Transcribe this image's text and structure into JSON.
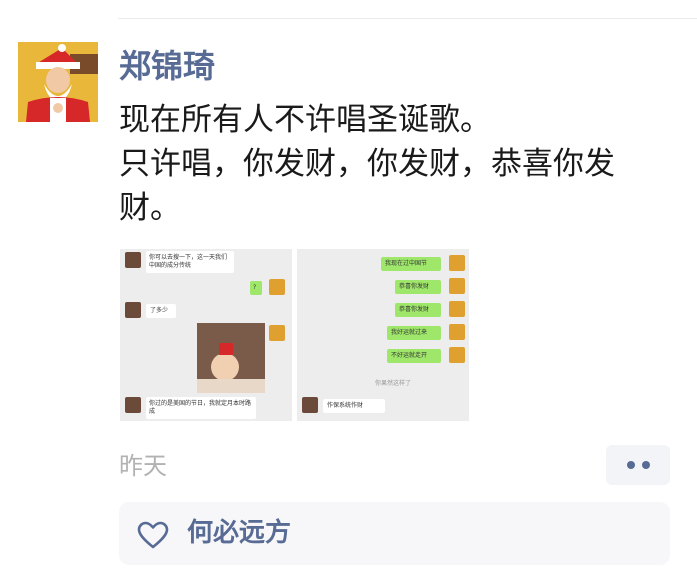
{
  "post": {
    "username": "郑锦琦",
    "text_lines": [
      "现在所有人不许唱圣诞歌。",
      "只许唱，你发财，你发财，恭喜你发财。"
    ],
    "time": "昨天",
    "liked_by": "何必远方",
    "more_icon": "more-dots-icon",
    "like_icon": "heart-icon"
  },
  "thumbnail1": {
    "messages": [
      "你可以去搜一下，这一天我们中国的成分传统",
      "?",
      "了多少",
      "你过的是美国的节日，我就定月本时路成"
    ]
  },
  "thumbnail2": {
    "messages": [
      "我现在过中国节",
      "恭喜你发财",
      "恭喜你发财",
      "我好运就过来",
      "不好运就走开",
      "你果然这样了",
      "作保系统作财"
    ]
  },
  "colors": {
    "link": "#576b95",
    "text": "#1a1a1a",
    "time": "#b2b2b2",
    "chat_green": "#9fe76a"
  }
}
